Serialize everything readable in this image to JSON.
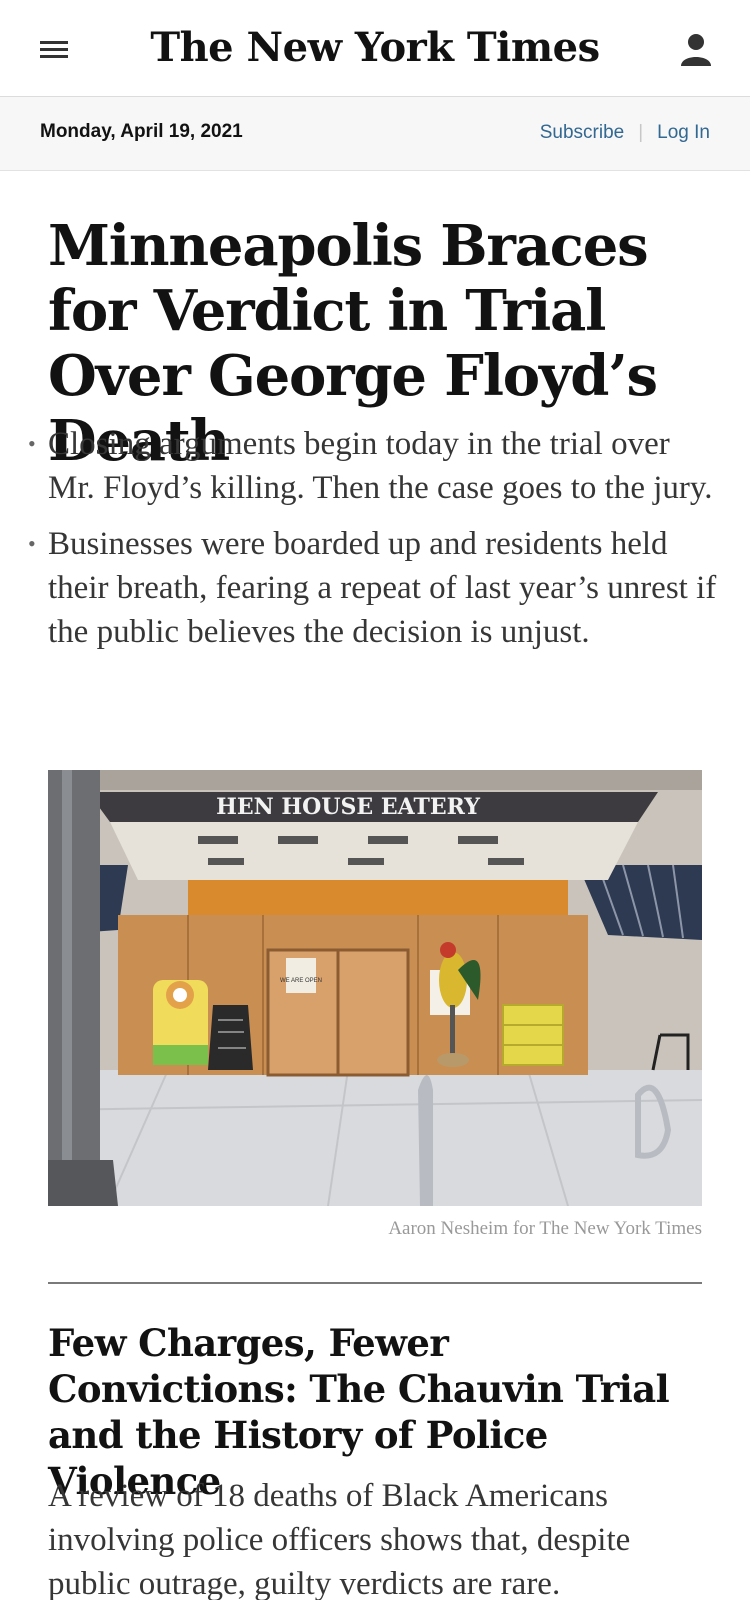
{
  "masthead": {
    "logo_text": "The New York Times",
    "menu_icon": "hamburger-menu-icon",
    "account_icon": "user-account-icon"
  },
  "datebar": {
    "date": "Monday, April 19, 2021",
    "subscribe_label": "Subscribe",
    "separator": "|",
    "login_label": "Log In",
    "link_color": "#326891"
  },
  "lead_story": {
    "headline": "Minneapolis Braces for Verdict in Trial Over George Floyd’s Death",
    "bullets": [
      "Closing arguments begin today in the trial over Mr. Floyd’s killing. Then the case goes to the jury.",
      "Businesses were boarded up and residents held their breath, fearing a repeat of last year’s unrest if the public believes the decision is unjust."
    ],
    "image": {
      "sign_text": "HEN HOUSE  EATERY",
      "door_sign_text": "WE ARE OPEN",
      "credit": "Aaron Nesheim for The New York Times"
    }
  },
  "second_story": {
    "headline": "Few Charges, Fewer Convictions: The Chauvin Trial and the History of Police Violence",
    "summary": "A review of 18 deaths of Black Americans involving police officers shows that, despite public outrage, guilty verdicts are rare."
  }
}
